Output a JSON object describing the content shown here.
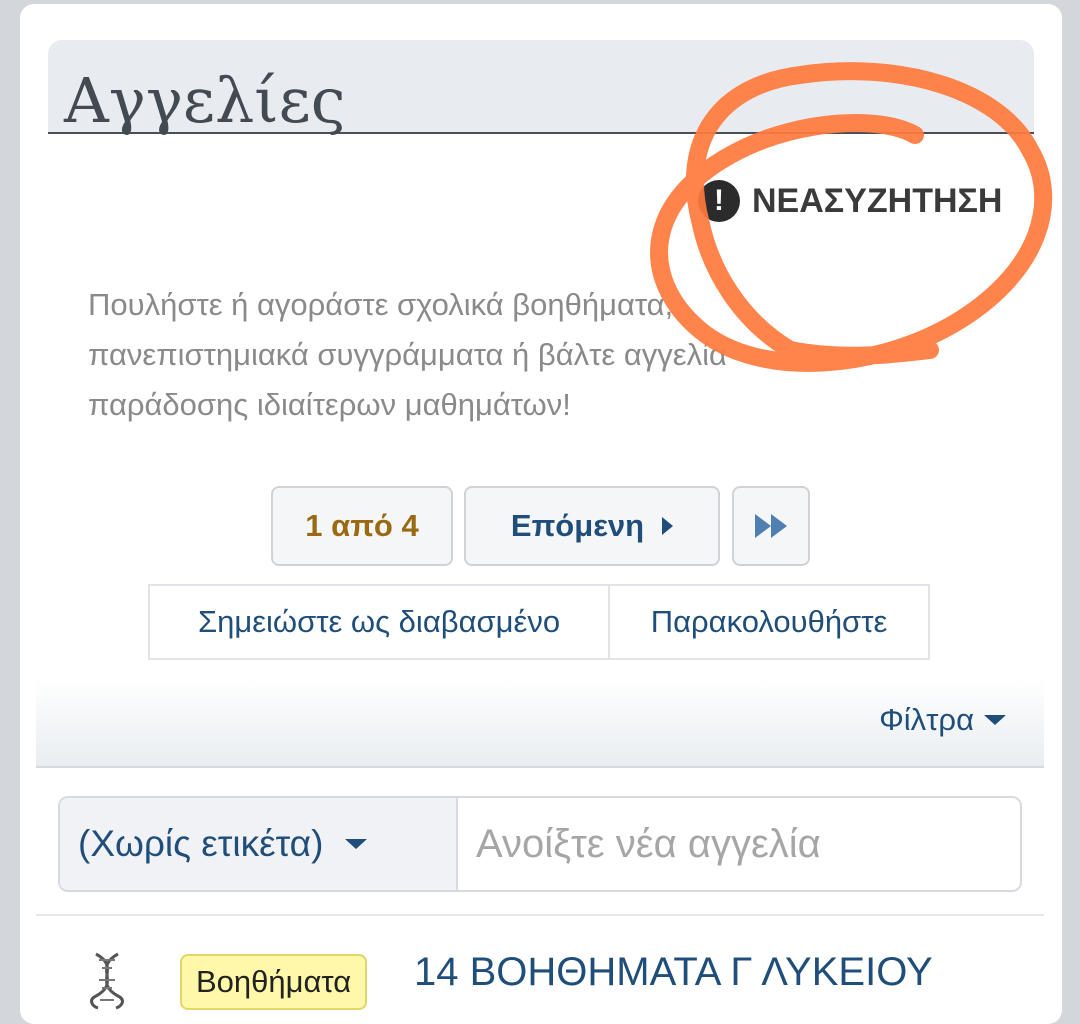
{
  "header": {
    "title": "Αγγελίες"
  },
  "new_discussion": {
    "label": "ΝΕΑΣΥΖΗΤΗΣΗ",
    "icon": "exclamation-bubble-icon"
  },
  "description": "Πουλήστε ή αγοράστε σχολικά βοηθήματα, πανεπιστημιακά συγγράμματα ή βάλτε αγγελία παράδοσης ιδιαίτερων μαθημάτων!",
  "pagination": {
    "current_label": "1 από 4",
    "next_label": "Επόμενη",
    "icons": {
      "next": "caret-right-icon",
      "last": "double-chevron-right-icon"
    }
  },
  "actions": {
    "mark_read": "Σημειώστε ως διαβασμένο",
    "watch": "Παρακολουθήστε"
  },
  "filters": {
    "label": "Φίλτρα"
  },
  "new_thread": {
    "prefix_label": "(Χωρίς ετικέτα)",
    "title_placeholder": "Ανοίξτε νέα αγγελία"
  },
  "threads": [
    {
      "prefix": "Βοηθήματα",
      "title": "14 ΒΟΗΘΗΜΑΤΑ Γ ΛΥΚΕΙΟΥ"
    }
  ],
  "colors": {
    "accent": "#1f4e7a",
    "page_counter": "#9a6a12",
    "highlight": "#ff7a3d",
    "prefix_tag_bg": "#fff8a8"
  }
}
